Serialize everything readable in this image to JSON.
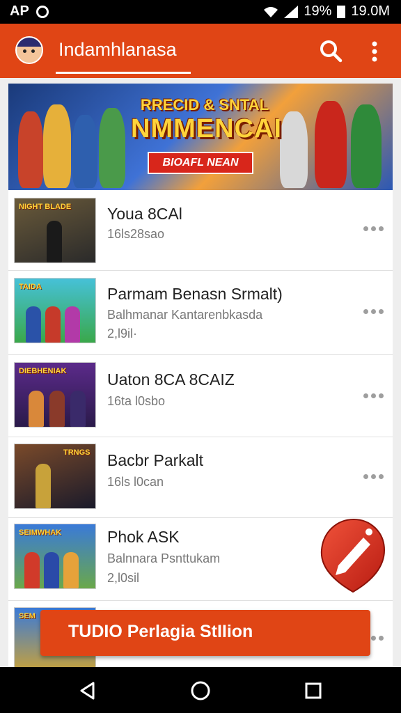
{
  "status_bar": {
    "app_label": "AP",
    "battery": "19%",
    "time": "19.0M"
  },
  "appbar": {
    "title": "Indamhlanasa",
    "search_icon": "search-icon",
    "menu_icon": "more-vert-icon"
  },
  "banner": {
    "headline": "RRECID & SNTAL",
    "big_text": "NMMENCAI",
    "ribbon": "BIOAFL NEAN"
  },
  "games": [
    {
      "thumb_label": "NIGHT BLADE",
      "title": "Youa 8CAl",
      "subtitle": "16ls28sao",
      "extra": ""
    },
    {
      "thumb_label": "TAIDA",
      "title": "Parmam Benasn Srmalt)",
      "subtitle": "Balhmanar Kantarenbkasda",
      "extra": "2,l9il·"
    },
    {
      "thumb_label": "DIEBHENIAK",
      "title": "Uaton 8CA 8CAIZ",
      "subtitle": "16ta l0sbo",
      "extra": ""
    },
    {
      "thumb_label": "TRNGS",
      "title": "Bacbr Parkalt",
      "subtitle": "16ls l0can",
      "extra": ""
    },
    {
      "thumb_label": "SEIMWHAK",
      "title": "Phok ASK",
      "subtitle": "Balnnara Psnttukam",
      "extra": "2,l0sil"
    },
    {
      "thumb_label": "SEM",
      "title": "",
      "subtitle": "",
      "extra": ""
    }
  ],
  "fab": {
    "icon": "edit-pencil-icon"
  },
  "snackbar": {
    "text": "TUDIO Perlagia StIIion"
  },
  "nav": {
    "back": "back-icon",
    "home": "home-icon",
    "recents": "recents-icon"
  },
  "colors": {
    "accent": "#e04515",
    "background": "#eeeeee"
  }
}
